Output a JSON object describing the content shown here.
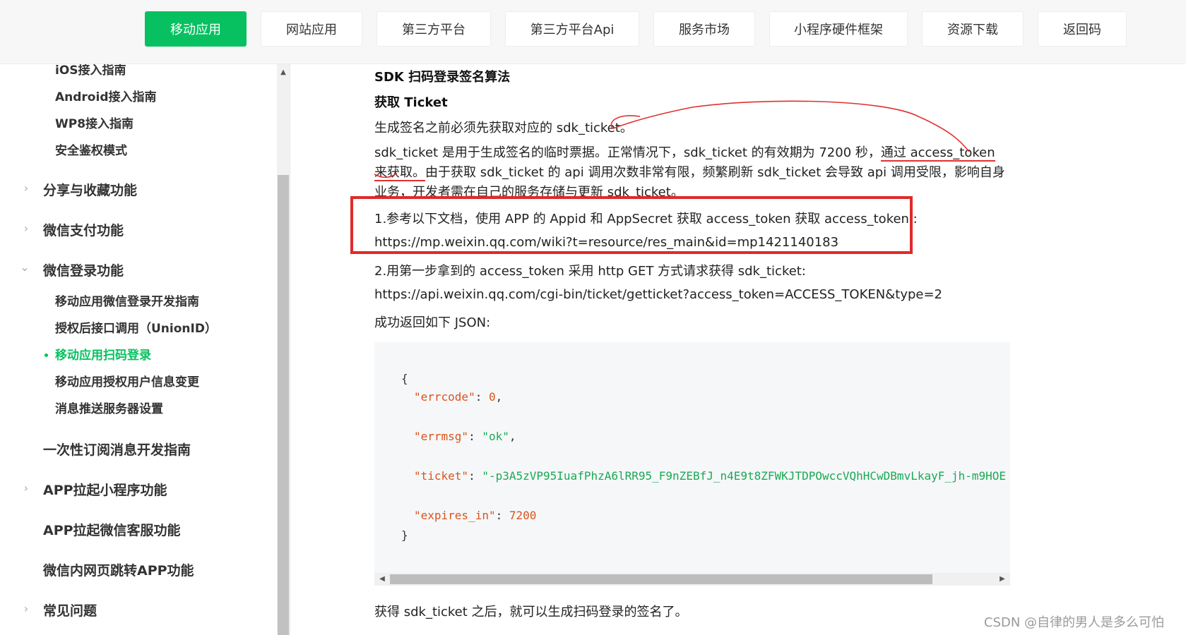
{
  "topnav": {
    "tabs": [
      {
        "label": "移动应用",
        "active": true
      },
      {
        "label": "网站应用"
      },
      {
        "label": "第三方平台"
      },
      {
        "label": "第三方平台Api"
      },
      {
        "label": "服务市场"
      },
      {
        "label": "小程序硬件框架"
      },
      {
        "label": "资源下载"
      },
      {
        "label": "返回码"
      }
    ]
  },
  "sidebar": {
    "items": [
      {
        "label": "iOS接入指南"
      },
      {
        "label": "Android接入指南"
      },
      {
        "label": "WP8接入指南"
      },
      {
        "label": "安全鉴权模式"
      },
      {
        "label": "分享与收藏功能"
      },
      {
        "label": "微信支付功能"
      },
      {
        "label": "微信登录功能"
      },
      {
        "label": "移动应用微信登录开发指南"
      },
      {
        "label": "授权后接口调用（UnionID）"
      },
      {
        "label": "移动应用扫码登录",
        "active": true
      },
      {
        "label": "移动应用授权用户信息变更"
      },
      {
        "label": "消息推送服务器设置"
      },
      {
        "label": "一次性订阅消息开发指南"
      },
      {
        "label": "APP拉起小程序功能"
      },
      {
        "label": "APP拉起微信客服功能"
      },
      {
        "label": "微信内网页跳转APP功能"
      },
      {
        "label": "常见问题"
      }
    ]
  },
  "content": {
    "section_title": "SDK 扫码登录签名算法",
    "subtitle": "获取 Ticket",
    "intro": "生成签名之前必须先获取对应的 sdk_ticket。",
    "para_a": "sdk_ticket 是用于生成签名的临时票据。正常情况下，sdk_ticket 的有效期为 7200 秒，",
    "para_b": "通过 access_token 来获取。",
    "para_c": "由于获取 sdk_ticket 的 api 调用次数非常有限，频繁刷新 sdk_ticket 会导致 api 调用受限，影响自身业务，开发者需在自己的服务存储与更新 sdk_ticket。",
    "step1": "1.参考以下文档，使用 APP 的 Appid 和 AppSecret 获取 access_token 获取 access_token,:",
    "step1_url": "https://mp.weixin.qq.com/wiki?t=resource/res_main&id=mp1421140183",
    "step2": "2.用第一步拿到的 access_token 采用 http GET 方式请求获得 sdk_ticket:",
    "step2_url": "https://api.weixin.qq.com/cgi-bin/ticket/getticket?access_token=ACCESS_TOKEN&type=2",
    "json_intro": "成功返回如下 JSON:",
    "code": {
      "open": "{",
      "errcode_key": "\"errcode\"",
      "errcode_val": "0",
      "errmsg_key": "\"errmsg\"",
      "errmsg_val": "\"ok\"",
      "ticket_key": "\"ticket\"",
      "ticket_val": "\"-p3A5zVP95IuafPhzA6lRR95_F9nZEBfJ_n4E9t8ZFWKJTDPOwccVQhHCwDBmvLkayF_jh-m9HOE",
      "expires_key": "\"expires_in\"",
      "expires_val": "7200",
      "close": "}",
      "colon": ": ",
      "comma": ","
    },
    "outro": "获得 sdk_ticket 之后，就可以生成扫码登录的签名了。"
  },
  "watermark": "CSDN @自律的男人是多么可怕"
}
